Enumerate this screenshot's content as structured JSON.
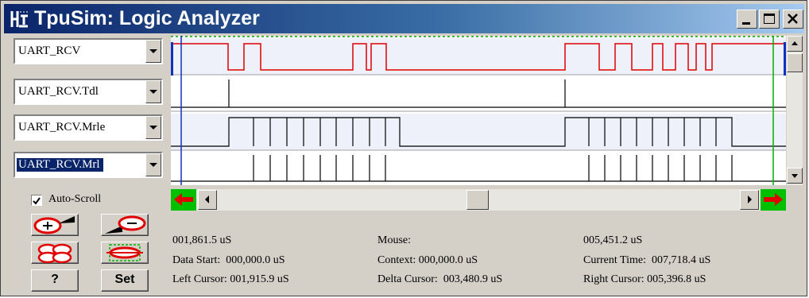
{
  "window": {
    "title": "TpuSim: Logic Analyzer",
    "minimize_icon": "minimize-icon",
    "maximize_icon": "maximize-icon",
    "close_icon": "close-icon"
  },
  "signals": [
    {
      "name": "UART_RCV",
      "selected": false
    },
    {
      "name": "UART_RCV.Tdl",
      "selected": false
    },
    {
      "name": "UART_RCV.Mrle",
      "selected": false
    },
    {
      "name": "UART_RCV.Mrl",
      "selected": true
    }
  ],
  "colors": {
    "titlebar_start": "#0a246a",
    "selection": "#0a246a",
    "waveform_active": "#e00000",
    "waveform": "#000000",
    "left_cursor": "#1030c0",
    "right_cursor": "#00b000",
    "nav_arrow": "#e00000",
    "nav_arrow_bg": "#00c000"
  },
  "auto_scroll": {
    "label": "Auto-Scroll",
    "checked": true
  },
  "tools": {
    "zoom_in_icon": "zoom-in-icon",
    "zoom_out_icon": "zoom-out-icon",
    "zoom_fit_icon": "zoom-fit-icon",
    "zoom_cursors_icon": "zoom-cursors-icon",
    "help_label": "?",
    "set_label": "Set"
  },
  "info": {
    "left_time": "001,861.5 uS",
    "data_start": "Data Start:  000,000.0 uS",
    "left_cursor": "Left Cursor: 001,915.9 uS",
    "mouse": "Mouse:",
    "context": "Context: 000,000.0 uS",
    "delta_cursor": "Delta Cursor:  003,480.9 uS",
    "right_time": "005,451.2 uS",
    "current_time": "Current Time:  007,718.4 uS",
    "right_cursor": "Right Cursor: 005,396.8 uS"
  }
}
